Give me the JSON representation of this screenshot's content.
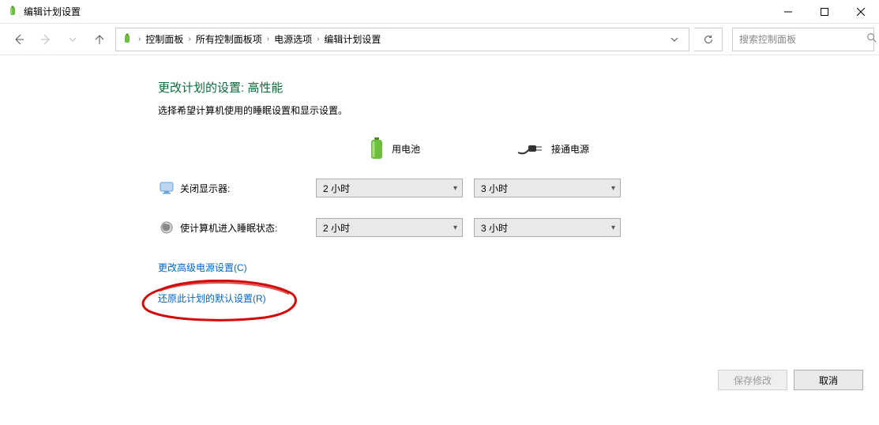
{
  "window": {
    "title": "编辑计划设置"
  },
  "breadcrumbs": {
    "items": [
      "控制面板",
      "所有控制面板项",
      "电源选项",
      "编辑计划设置"
    ]
  },
  "search": {
    "placeholder": "搜索控制面板"
  },
  "page": {
    "heading": "更改计划的设置: 高性能",
    "subheading": "选择希望计算机使用的睡眠设置和显示设置。",
    "col_battery": "用电池",
    "col_plugged": "接通电源",
    "rows": [
      {
        "label": "关闭显示器:",
        "battery": "2 小时",
        "plugged": "3 小时"
      },
      {
        "label": "使计算机进入睡眠状态:",
        "battery": "2 小时",
        "plugged": "3 小时"
      }
    ],
    "link_advanced": "更改高级电源设置(C)",
    "link_restore": "还原此计划的默认设置(R)",
    "btn_save": "保存修改",
    "btn_cancel": "取消"
  }
}
